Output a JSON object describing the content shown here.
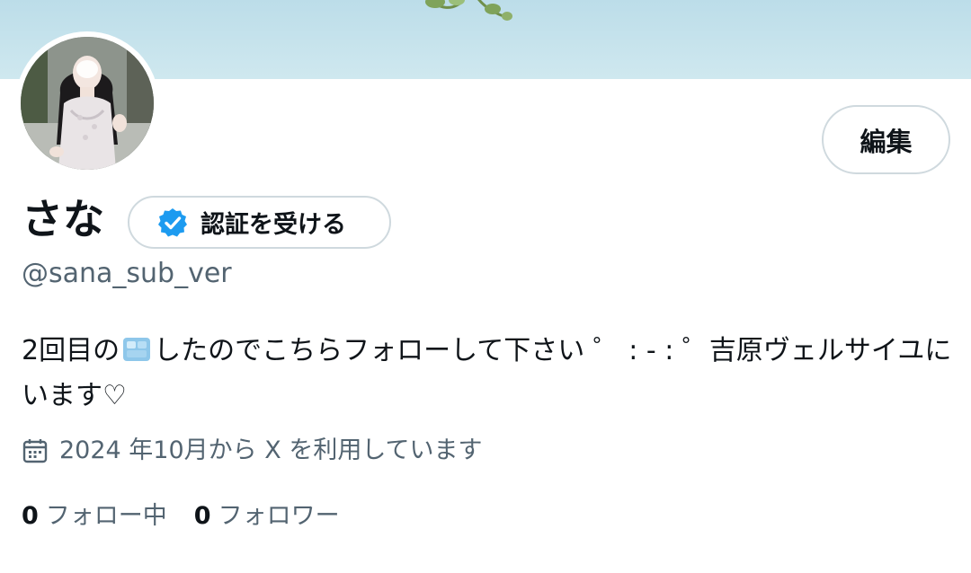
{
  "profile": {
    "display_name": "さな",
    "handle": "@sana_sub_ver",
    "bio_part1": "2回目の",
    "bio_part2": "したのでこちらフォローして下さい ゜ : - : ゜吉原ヴェルサイユにいます♡",
    "joined": "2024 年10月から X を利用しています"
  },
  "buttons": {
    "edit": "編集",
    "verify": "認証を受ける"
  },
  "stats": {
    "following_count": "0",
    "following_label": "フォロー中",
    "followers_count": "0",
    "followers_label": "フォロワー"
  },
  "icons": {
    "verified": "verified-badge-icon",
    "calendar": "calendar-icon",
    "ice": "ice-cube-emoji"
  },
  "colors": {
    "verified_blue": "#1d9bf0",
    "secondary_text": "#536471",
    "border": "#cfd9de",
    "banner": "#c6e3ec"
  }
}
